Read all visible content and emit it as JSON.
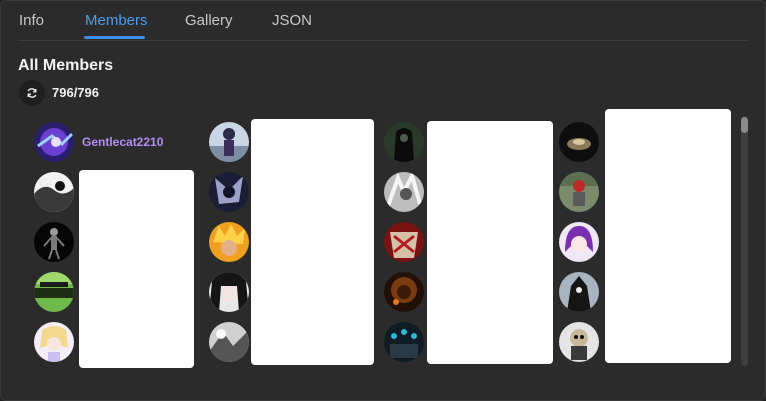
{
  "tabs": [
    {
      "label": "Info",
      "active": false
    },
    {
      "label": "Members",
      "active": true
    },
    {
      "label": "Gallery",
      "active": false
    },
    {
      "label": "JSON",
      "active": false
    }
  ],
  "section": {
    "title": "All Members",
    "refresh_icon": "refresh-icon",
    "count": "796/796"
  },
  "members": {
    "highlighted_name": "Gentlecat2210",
    "highlighted_color": "#b48ef0"
  },
  "colors": {
    "accent": "#3c8ee8",
    "background": "#2b2b2b"
  }
}
